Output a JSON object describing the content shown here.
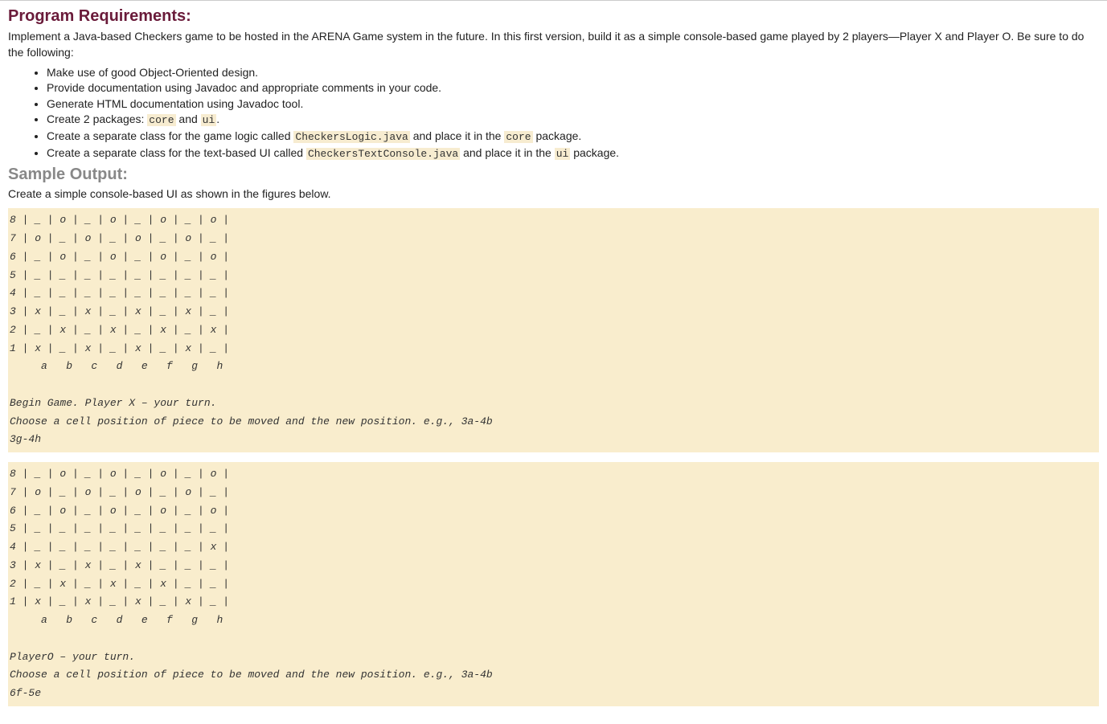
{
  "heading_requirements": "Program Requirements:",
  "intro_paragraph": "Implement a Java-based Checkers game to be hosted in the ARENA Game system in the future. In this first version, build it as a simple console-based game played by 2 players—Player X and Player O. Be sure to do the following:",
  "bullets": {
    "b1": "Make use of good Object-Oriented design.",
    "b2": "Provide documentation using Javadoc and appropriate comments in your code.",
    "b3": "Generate HTML documentation using Javadoc tool.",
    "b4_pre": "Create 2 packages: ",
    "b4_code1": "core",
    "b4_mid": " and ",
    "b4_code2": "ui",
    "b4_post": ".",
    "b5_pre": "Create a separate class for the game logic called ",
    "b5_code1": "CheckersLogic.java",
    "b5_mid": " and place it in the ",
    "b5_code2": "core",
    "b5_post": " package.",
    "b6_pre": "Create a separate class for the text-based UI called ",
    "b6_code1": "CheckersTextConsole.java",
    "b6_mid": " and place it in the ",
    "b6_code2": "ui",
    "b6_post": " package."
  },
  "heading_sample": "Sample Output:",
  "sample_subtext": "Create a simple console-based UI as shown in the figures below.",
  "code_block_1": "8 | _ | o | _ | o | _ | o | _ | o |\n7 | o | _ | o | _ | o | _ | o | _ |\n6 | _ | o | _ | o | _ | o | _ | o |\n5 | _ | _ | _ | _ | _ | _ | _ | _ |\n4 | _ | _ | _ | _ | _ | _ | _ | _ |\n3 | x | _ | x | _ | x | _ | x | _ |\n2 | _ | x | _ | x | _ | x | _ | x |\n1 | x | _ | x | _ | x | _ | x | _ |\n     a   b   c   d   e   f   g   h\n\nBegin Game. Player X – your turn.\nChoose a cell position of piece to be moved and the new position. e.g., 3a-4b\n3g-4h",
  "code_block_2": "8 | _ | o | _ | o | _ | o | _ | o |\n7 | o | _ | o | _ | o | _ | o | _ |\n6 | _ | o | _ | o | _ | o | _ | o |\n5 | _ | _ | _ | _ | _ | _ | _ | _ |\n4 | _ | _ | _ | _ | _ | _ | _ | x |\n3 | x | _ | x | _ | x | _ | _ | _ |\n2 | _ | x | _ | x | _ | x | _ | _ |\n1 | x | _ | x | _ | x | _ | x | _ |\n     a   b   c   d   e   f   g   h\n\nPlayerO – your turn.\nChoose a cell position of piece to be moved and the new position. e.g., 3a-4b\n6f-5e"
}
